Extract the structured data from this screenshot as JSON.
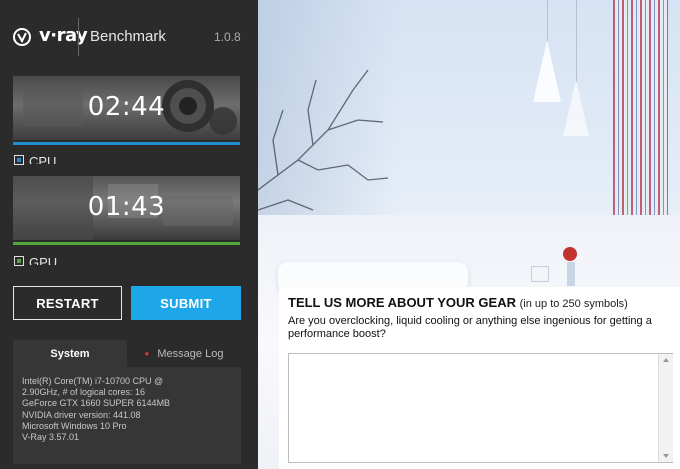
{
  "app": {
    "logo_text": "v·ray",
    "title": "Benchmark",
    "version": "1.0.8"
  },
  "tests": [
    {
      "id": "cpu",
      "time": "02:44",
      "label": "CPU",
      "checked": true,
      "color": "#1e8fd0"
    },
    {
      "id": "gpu",
      "time": "01:43",
      "label": "GPU",
      "checked": true,
      "color": "#4ea83a"
    }
  ],
  "buttons": {
    "restart": "RESTART",
    "submit": "SUBMIT"
  },
  "info_tabs": {
    "system": "System",
    "message_log": "Message Log"
  },
  "system_info": "Intel(R) Core(TM) i7-10700 CPU @\n2.90GHz, # of logical cores: 16\nGeForce GTX 1660 SUPER 6144MB\nNVIDIA driver version: 441.08\nMicrosoft Windows 10 Pro\nV-Ray 3.57.01",
  "gear_form": {
    "title": "TELL US MORE ABOUT YOUR GEAR",
    "limit": "(in up to 250 symbols)",
    "question": "Are you overclocking, liquid cooling or anything else ingenious for getting a performance boost?",
    "input_value": ""
  },
  "colors": {
    "accent": "#1ea7e8",
    "cpu": "#1e8fd0",
    "gpu": "#4ea83a",
    "sidebar_bg": "#2b2b2b"
  }
}
